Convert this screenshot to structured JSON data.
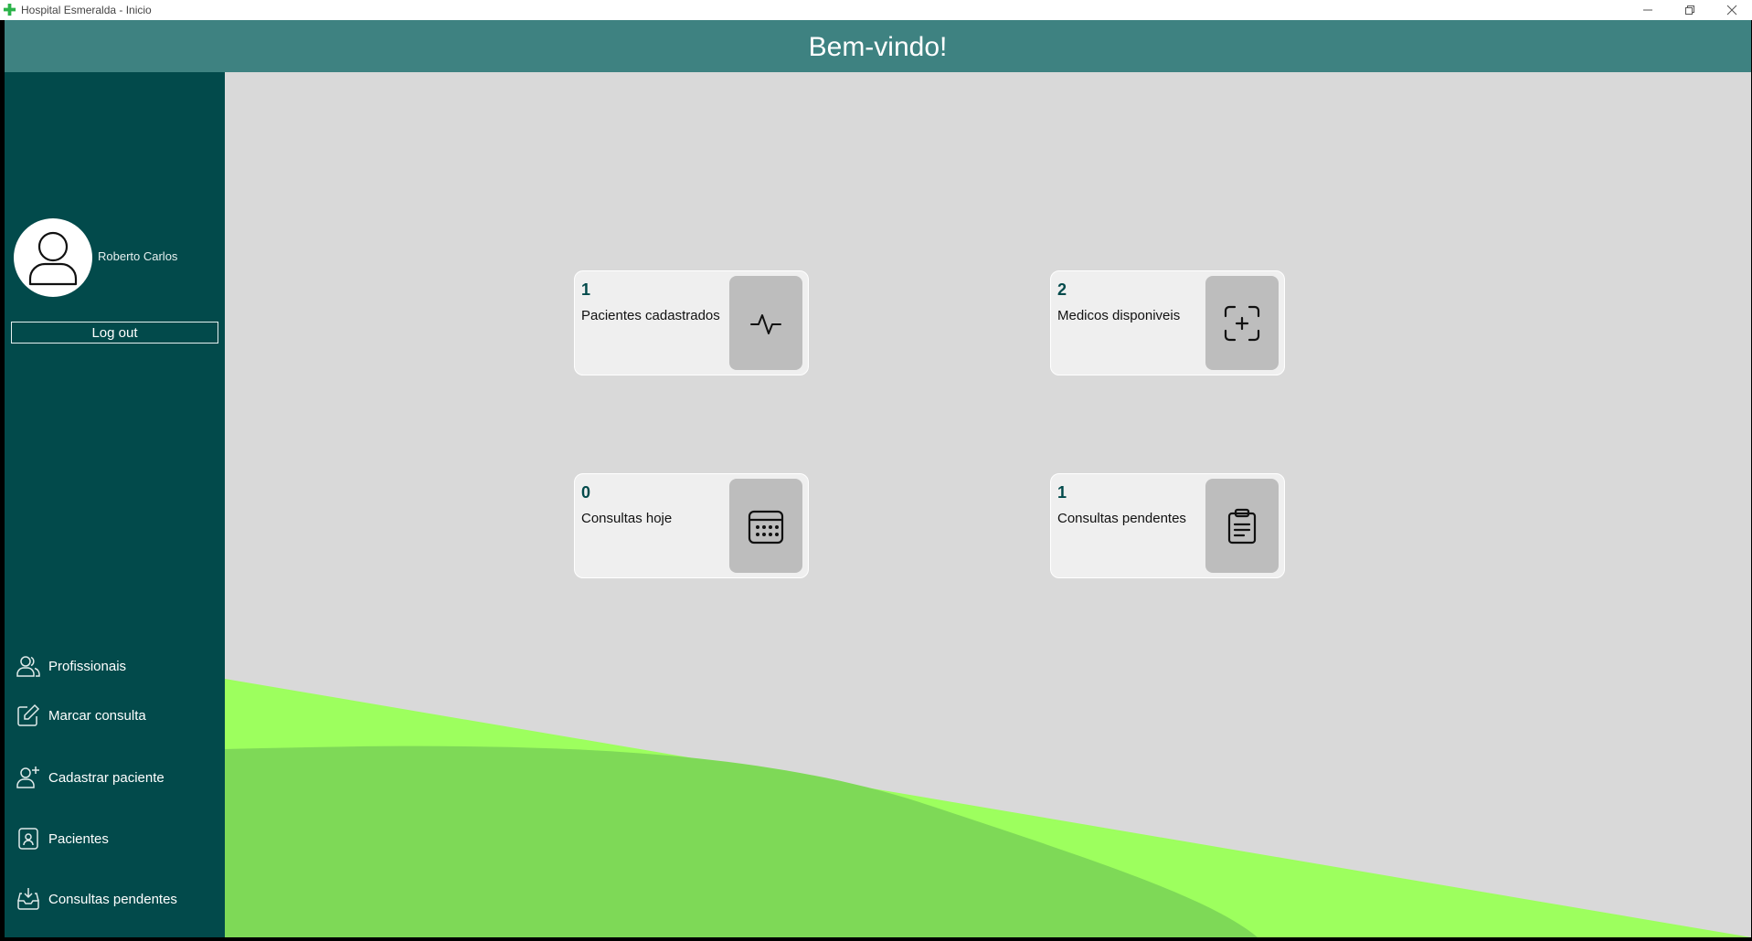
{
  "window": {
    "title": "Hospital Esmeralda - Inicio"
  },
  "header": {
    "heading": "Bem-vindo!"
  },
  "sidebar": {
    "user_name": "Roberto Carlos",
    "logout_label": "Log out",
    "nav": [
      {
        "label": "Profissionais",
        "icon": "users-icon"
      },
      {
        "label": "Marcar consulta",
        "icon": "edit-icon"
      },
      {
        "label": "Cadastrar paciente",
        "icon": "user-plus-icon"
      },
      {
        "label": "Pacientes",
        "icon": "id-badge-icon"
      },
      {
        "label": "Consultas pendentes",
        "icon": "inbox-download-icon"
      }
    ]
  },
  "cards": [
    {
      "count": "1",
      "label": "Pacientes cadastrados",
      "icon": "heartbeat-icon"
    },
    {
      "count": "2",
      "label": "Medicos disponiveis",
      "icon": "scan-plus-icon"
    },
    {
      "count": "0",
      "label": "Consultas hoje",
      "icon": "calendar-icon"
    },
    {
      "count": "1",
      "label": "Consultas pendentes",
      "icon": "clipboard-icon"
    }
  ],
  "colors": {
    "header": "#3e8281",
    "sidebar": "#024a4b",
    "background": "#d9d9d9",
    "wave_light": "#9dff5e",
    "wave_dark": "#7ed957"
  }
}
